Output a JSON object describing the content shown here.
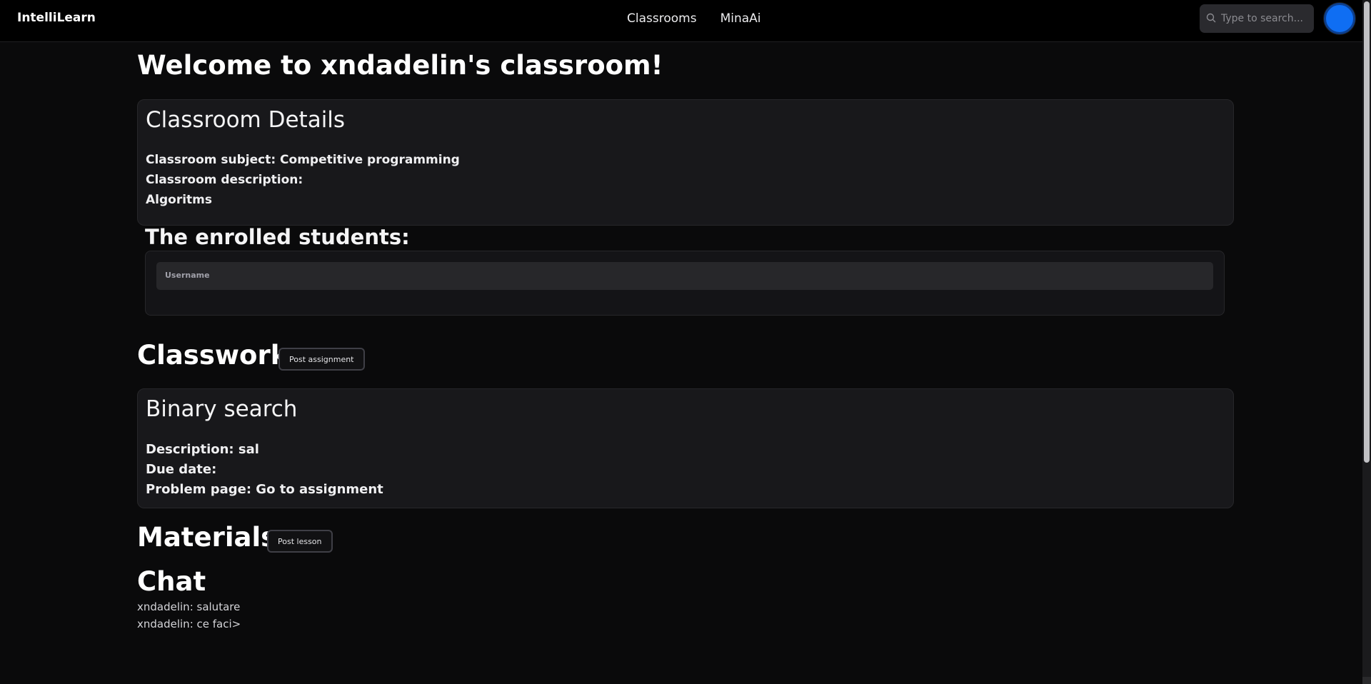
{
  "nav": {
    "brand": "IntelliLearn",
    "links": [
      "Classrooms",
      "MinaAi"
    ],
    "search_placeholder": "Type to search..."
  },
  "page": {
    "title": "Welcome to xndadelin's classroom!"
  },
  "classroom_details": {
    "title": "Classroom Details",
    "subject_line": "Classroom subject: Competitive programming",
    "description_label": "Classroom description:",
    "description_value": "Algoritms",
    "enrolled_heading": "The enrolled students:",
    "table_header": "Username"
  },
  "classwork": {
    "title": "Classwork",
    "post_button": "Post assignment",
    "assignment": {
      "title": "Binary search",
      "description_line": "Description: sal",
      "due_line": "Due date:",
      "problem_line": "Problem page: Go to assignment"
    }
  },
  "materials": {
    "title": "Materials",
    "post_button": "Post lesson"
  },
  "chat": {
    "title": "Chat",
    "messages": [
      "xndadelin: salutare",
      "xndadelin: ce faci>"
    ]
  },
  "colors": {
    "avatar": "#0f6ef3",
    "background": "#0a0a0b",
    "card": "#18181b"
  }
}
